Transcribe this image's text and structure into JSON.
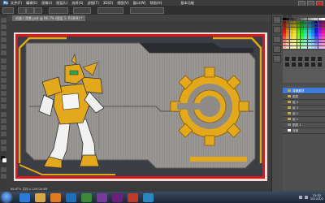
{
  "menubar": {
    "logo": "Ps",
    "items": [
      "文件(F)",
      "编辑(E)",
      "图像(I)",
      "图层(L)",
      "选择(S)",
      "滤镜(T)",
      "3D(D)",
      "视图(V)",
      "窗口(W)",
      "帮助(H)"
    ],
    "workspace_label": "基本功能"
  },
  "document": {
    "tab_label": "机器人背景.psd @ 66.7% (图层 1, RGB/8) *",
    "status_text": "66.67%   文档:4.12M/28.6M"
  },
  "layers": {
    "rows": [
      "背景素材",
      "图层",
      "组 4",
      "组 3",
      "组 2",
      "组 1",
      "图层 1",
      "背景"
    ],
    "selected_index": 0
  },
  "icons": {
    "start": "windows-start-icon",
    "taskbar": [
      "ie-icon",
      "folder-icon",
      "media-icon",
      "photoshop-icon",
      "app-icon",
      "app-icon",
      "visual-studio-icon",
      "app-icon",
      "app-icon"
    ],
    "taskbar_colors": [
      "#2b7bd6",
      "#d9a441",
      "#e07a1f",
      "#1d6fb8",
      "#3a8a3a",
      "#7a3a9a",
      "#68217a",
      "#c0392b",
      "#2e86c1"
    ]
  },
  "tray": {
    "time": "13:32",
    "date": "2012/5/2"
  },
  "colors": {
    "accent_frame": "#d81a1a",
    "gold": "#e3a81c",
    "layer_selected": "#3e7bd6"
  }
}
